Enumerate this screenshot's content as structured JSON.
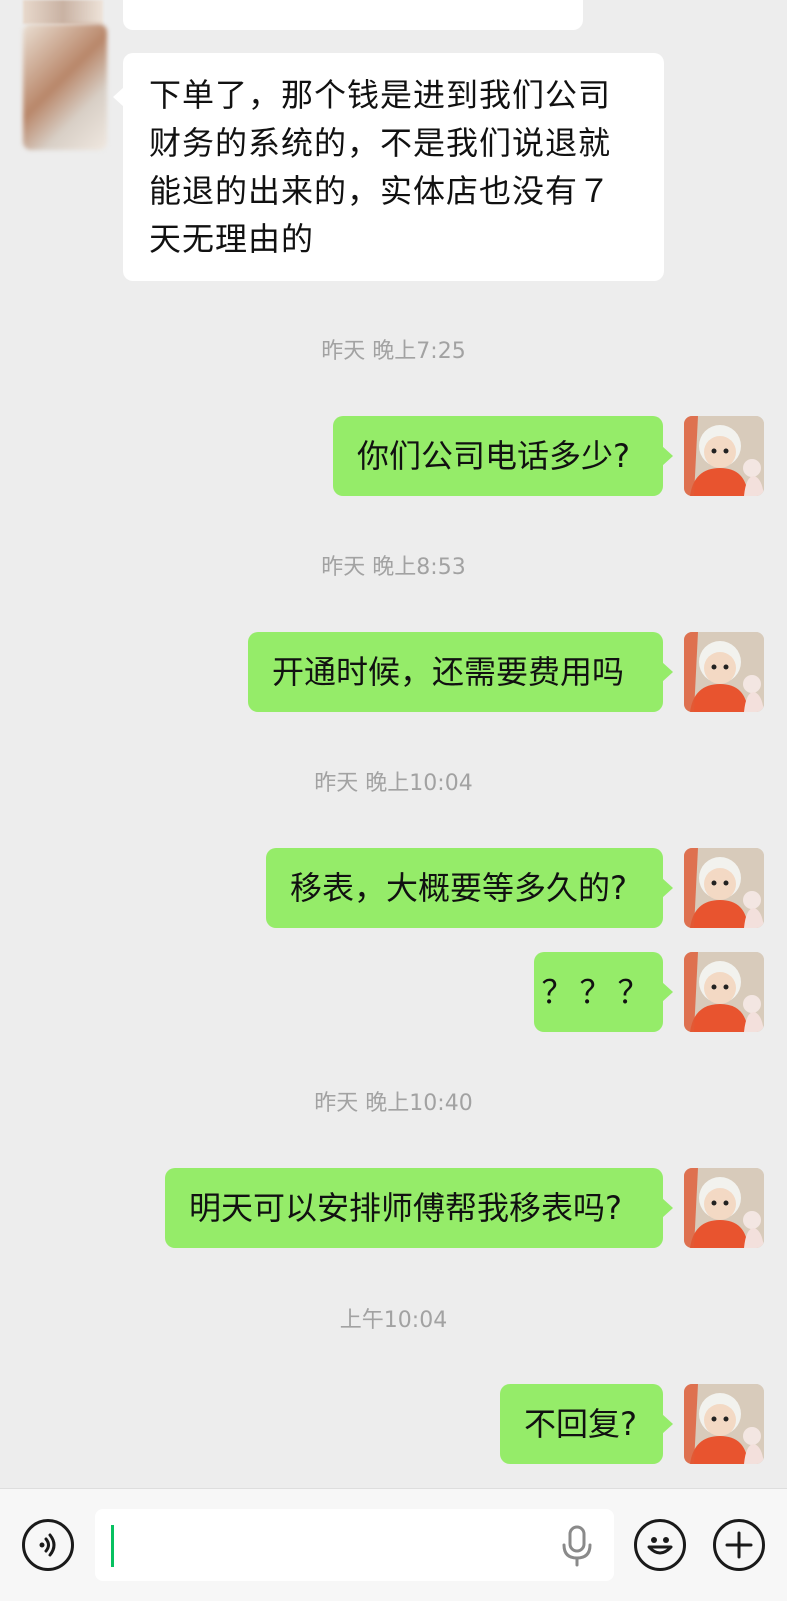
{
  "messages": {
    "incoming_1": "下单了，那个钱是进到我们公司财务的系统的，不是我们说退就能退的出来的，实体店也没有７天无理由的",
    "ts_1": "昨天 晚上7:25",
    "out_1": "你们公司电话多少?",
    "ts_2": "昨天 晚上8:53",
    "out_2": "开通时候，还需要费用吗",
    "ts_3": "昨天 晚上10:04",
    "out_3": "移表，大概要等多久的?",
    "out_4": "？？？",
    "ts_4": "昨天 晚上10:40",
    "out_5": "明天可以安排师傅帮我移表吗?",
    "ts_5": "上午10:04",
    "out_6": "不回复?"
  },
  "colors": {
    "background": "#ededed",
    "outgoing_bubble": "#95ec69",
    "incoming_bubble": "#ffffff",
    "cursor": "#07c160"
  },
  "icons": {
    "voice": "voice-icon",
    "mic": "mic-icon",
    "emoji": "emoji-icon",
    "more": "plus-icon"
  }
}
